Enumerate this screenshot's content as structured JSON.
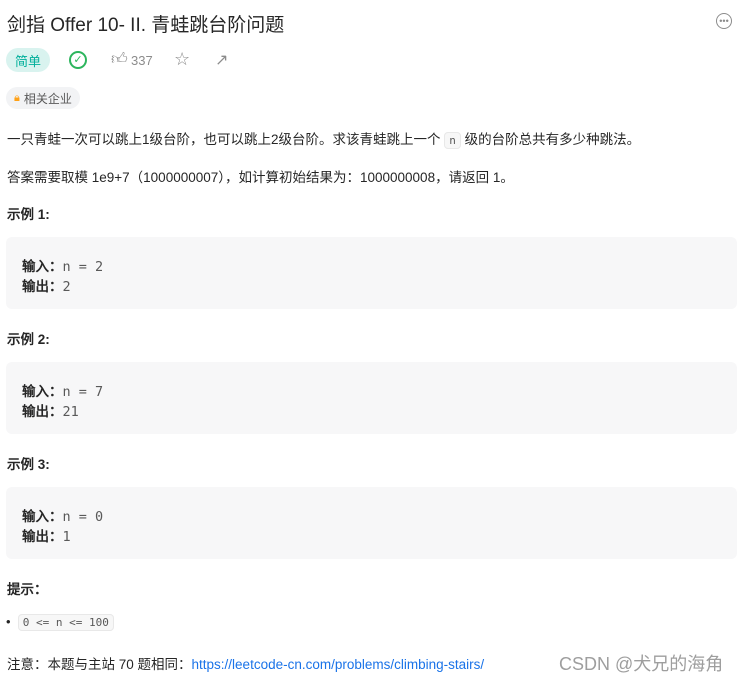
{
  "title": "剑指 Offer 10- II. 青蛙跳台阶问题",
  "difficulty": "简单",
  "likes": "337",
  "tag": "相关企业",
  "desc1_pre": "一只青蛙一次可以跳上1级台阶，也可以跳上2级台阶。求该青蛙跳上一个 ",
  "desc1_code": "n",
  "desc1_post": " 级的台阶总共有多少种跳法。",
  "desc2": "答案需要取模 1e9+7（1000000007），如计算初始结果为：1000000008，请返回 1。",
  "examples": [
    {
      "title": "示例 1:",
      "in_label": "输入：",
      "in": "n = 2",
      "out_label": "输出：",
      "out": "2"
    },
    {
      "title": "示例 2:",
      "in_label": "输入：",
      "in": "n = 7",
      "out_label": "输出：",
      "out": "21"
    },
    {
      "title": "示例 3:",
      "in_label": "输入：",
      "in": "n = 0",
      "out_label": "输出：",
      "out": "1"
    }
  ],
  "hint_title": "提示：",
  "hint": "0 <= n <= 100",
  "note": "注意：本题与主站 70 题相同：",
  "link": "https://leetcode-cn.com/problems/climbing-stairs/",
  "watermark": "CSDN @犬兄的海角"
}
